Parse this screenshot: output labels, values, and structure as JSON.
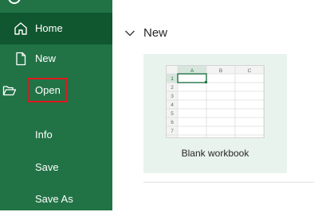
{
  "sidebar": {
    "items": [
      {
        "label": "Home",
        "icon": "home-icon",
        "selected": true
      },
      {
        "label": "New",
        "icon": "new-document-icon"
      },
      {
        "label": "Open",
        "icon": "open-folder-icon",
        "highlighted": true
      },
      {
        "label": "Info"
      },
      {
        "label": "Save"
      },
      {
        "label": "Save As"
      }
    ],
    "bg_color": "#217346",
    "selected_color": "#10572f"
  },
  "main": {
    "section_title": "New",
    "templates": [
      {
        "label": "Blank workbook"
      }
    ],
    "thumbnail": {
      "column_headers": [
        "A",
        "B",
        "C"
      ],
      "row_headers": [
        "1",
        "2",
        "3",
        "4",
        "5",
        "6",
        "7"
      ]
    }
  },
  "colors": {
    "highlight_box": "#e0161e",
    "tile_bg": "#e9f3ee"
  }
}
